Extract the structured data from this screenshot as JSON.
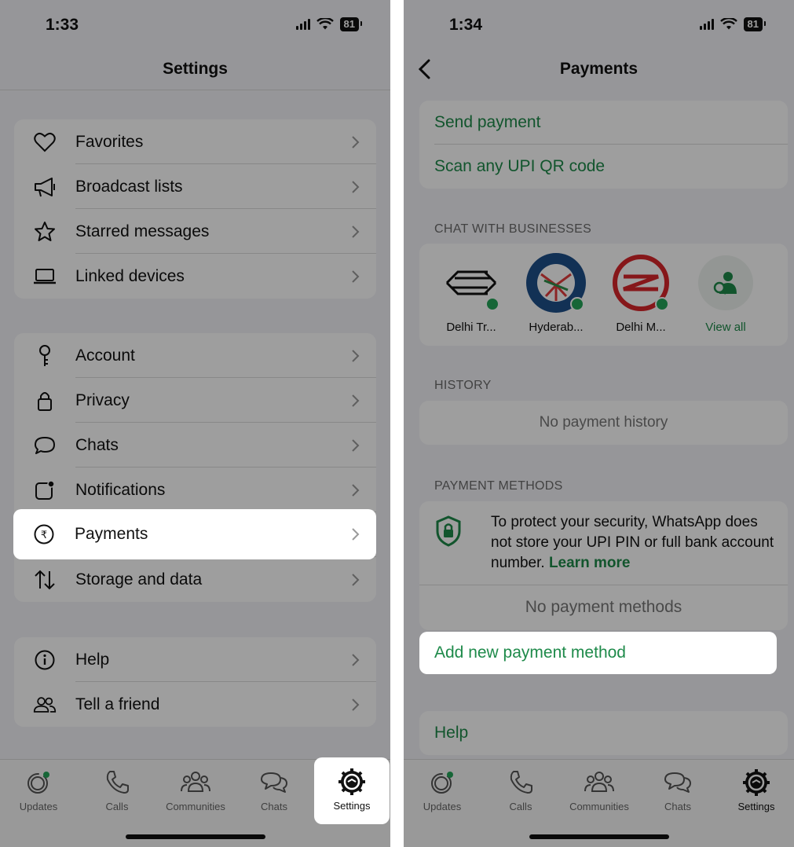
{
  "left": {
    "status": {
      "time": "1:33",
      "battery": "81"
    },
    "title": "Settings",
    "groups": [
      [
        {
          "icon": "heart-icon",
          "label": "Favorites"
        },
        {
          "icon": "megaphone-icon",
          "label": "Broadcast lists"
        },
        {
          "icon": "star-icon",
          "label": "Starred messages"
        },
        {
          "icon": "laptop-icon",
          "label": "Linked devices"
        }
      ],
      [
        {
          "icon": "key-icon",
          "label": "Account"
        },
        {
          "icon": "lock-icon",
          "label": "Privacy"
        },
        {
          "icon": "chat-bubble-icon",
          "label": "Chats"
        },
        {
          "icon": "notification-icon",
          "label": "Notifications"
        },
        {
          "icon": "rupee-icon",
          "label": "Payments"
        },
        {
          "icon": "arrows-updown-icon",
          "label": "Storage and data"
        }
      ],
      [
        {
          "icon": "info-icon",
          "label": "Help"
        },
        {
          "icon": "people-icon",
          "label": "Tell a friend"
        }
      ]
    ]
  },
  "right": {
    "status": {
      "time": "1:34",
      "battery": "81"
    },
    "title": "Payments",
    "actions": [
      "Send payment",
      "Scan any UPI QR code"
    ],
    "businesses_header": "CHAT WITH BUSINESSES",
    "businesses": [
      {
        "name": "Delhi Tr...",
        "icon": "delhi-transport-logo"
      },
      {
        "name": "Hyderab...",
        "icon": "hyderabad-metro-logo"
      },
      {
        "name": "Delhi M...",
        "icon": "delhi-metro-logo"
      }
    ],
    "view_all": "View all",
    "history_header": "HISTORY",
    "history_empty": "No payment history",
    "methods_header": "PAYMENT METHODS",
    "security_text": "To protect your security, WhatsApp does not store your UPI PIN or full bank account number.",
    "learn_more": "Learn more",
    "no_methods": "No payment methods",
    "add_method": "Add new payment method",
    "help": "Help"
  },
  "tabs": [
    "Updates",
    "Calls",
    "Communities",
    "Chats",
    "Settings"
  ],
  "colors": {
    "accent": "#1e8a4a",
    "background": "#f2f2f7"
  }
}
